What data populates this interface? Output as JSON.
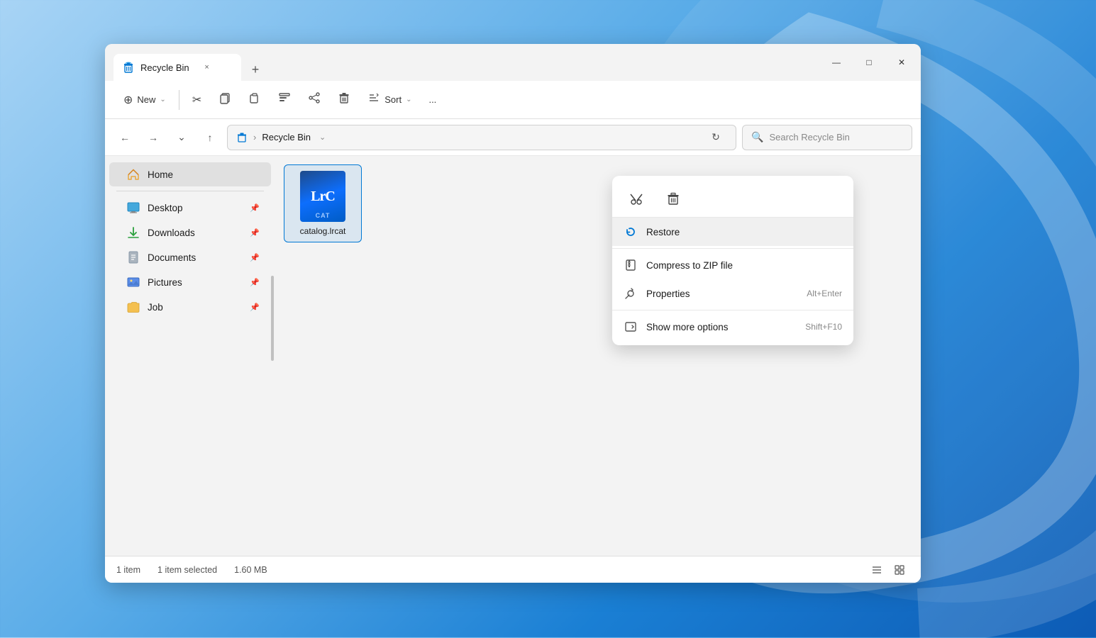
{
  "window": {
    "tab_title": "Recycle Bin",
    "tab_close_label": "×",
    "tab_add_label": "+",
    "controls": {
      "minimize": "—",
      "maximize": "□",
      "close": "✕"
    }
  },
  "toolbar": {
    "new_label": "New",
    "new_chevron": "⌄",
    "cut_label": "Cut",
    "copy_label": "Copy",
    "paste_label": "Paste",
    "rename_label": "Rename",
    "share_label": "Share",
    "delete_label": "Delete",
    "sort_label": "Sort",
    "sort_chevron": "⌄",
    "more_label": "..."
  },
  "address_bar": {
    "location": "Recycle Bin",
    "chevron": "⌄",
    "refresh": "↻",
    "search_placeholder": "Search Recycle Bin"
  },
  "nav": {
    "back": "←",
    "forward": "→",
    "recent": "⌄",
    "up": "↑"
  },
  "sidebar": {
    "items": [
      {
        "label": "Home",
        "icon": "home",
        "active": true,
        "pin": false
      },
      {
        "label": "Desktop",
        "icon": "desktop",
        "active": false,
        "pin": true
      },
      {
        "label": "Downloads",
        "icon": "download",
        "active": false,
        "pin": true
      },
      {
        "label": "Documents",
        "icon": "documents",
        "active": false,
        "pin": true
      },
      {
        "label": "Pictures",
        "icon": "pictures",
        "active": false,
        "pin": true
      },
      {
        "label": "Job",
        "icon": "folder-yellow",
        "active": false,
        "pin": true
      }
    ]
  },
  "file_item": {
    "name": "catalog.lrcat",
    "icon_text": "LrC",
    "icon_badge": "CAT"
  },
  "context_menu": {
    "tools": [
      {
        "label": "Cut",
        "icon": "✂"
      },
      {
        "label": "Delete",
        "icon": "🗑"
      }
    ],
    "items": [
      {
        "label": "Restore",
        "icon": "restore",
        "shortcut": "",
        "active": true
      },
      {
        "label": "Compress to ZIP file",
        "icon": "zip",
        "shortcut": ""
      },
      {
        "label": "Properties",
        "icon": "wrench",
        "shortcut": "Alt+Enter"
      },
      {
        "label": "Show more options",
        "icon": "arrow-box",
        "shortcut": "Shift+F10"
      }
    ]
  },
  "status_bar": {
    "item_count": "1 item",
    "selected": "1 item selected",
    "size": "1.60 MB"
  }
}
